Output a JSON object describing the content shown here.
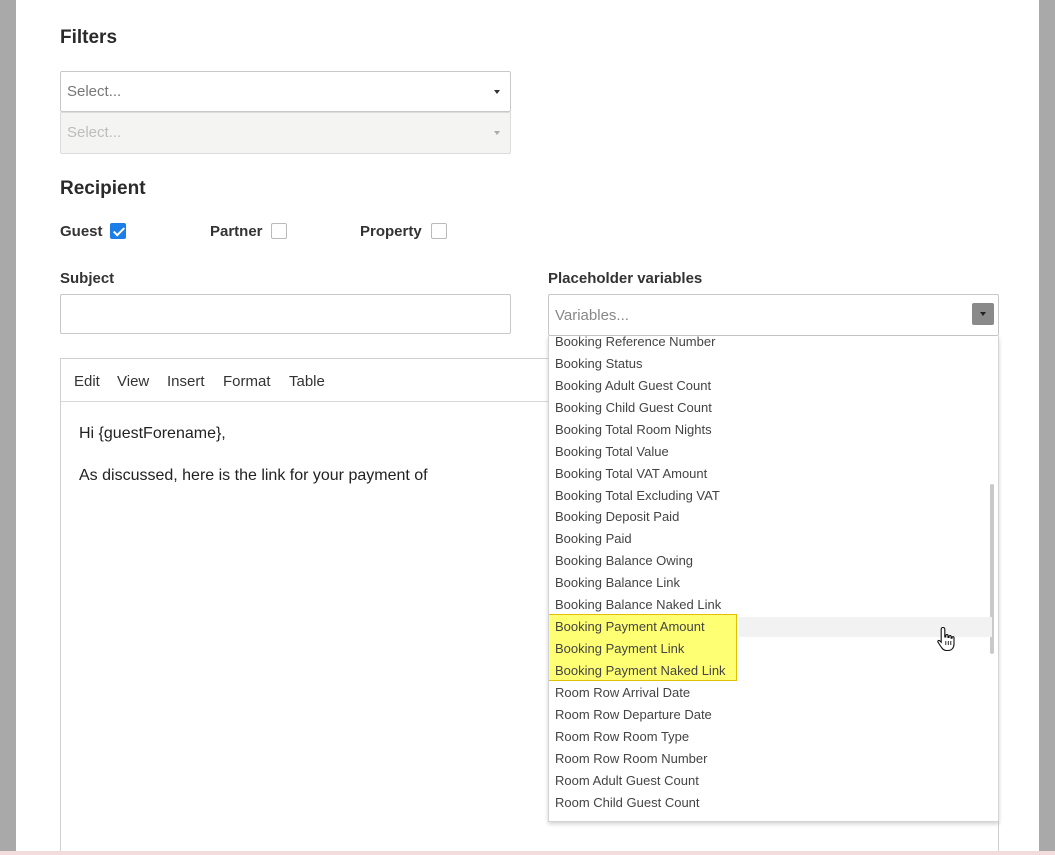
{
  "filters": {
    "heading": "Filters",
    "select1_placeholder": "Select...",
    "select2_placeholder": "Select..."
  },
  "recipient": {
    "heading": "Recipient",
    "guest_label": "Guest",
    "guest_checked": true,
    "partner_label": "Partner",
    "partner_checked": false,
    "property_label": "Property",
    "property_checked": false
  },
  "subject": {
    "label": "Subject",
    "value": ""
  },
  "placeholder_variables": {
    "label": "Placeholder variables",
    "placeholder": "Variables...",
    "options": [
      "Booking Reference Number",
      "Booking Status",
      "Booking Adult Guest Count",
      "Booking Child Guest Count",
      "Booking Total Room Nights",
      "Booking Total Value",
      "Booking Total VAT Amount",
      "Booking Total Excluding VAT",
      "Booking Deposit Paid",
      "Booking Paid",
      "Booking Balance Owing",
      "Booking Balance Link",
      "Booking Balance Naked Link",
      "Booking Payment Amount",
      "Booking Payment Link",
      "Booking Payment Naked Link",
      "Room Row Arrival Date",
      "Room Row Departure Date",
      "Room Row Room Type",
      "Room Row Room Number",
      "Room Adult Guest Count",
      "Room Child Guest Count"
    ],
    "hovered_option": "Booking Payment Amount",
    "highlighted_options": [
      "Booking Payment Amount",
      "Booking Payment Link",
      "Booking Payment Naked Link"
    ],
    "highlight_color": "#ffff00"
  },
  "editor": {
    "menu": [
      "Edit",
      "View",
      "Insert",
      "Format",
      "Table"
    ],
    "line1": "Hi {guestForename},",
    "line2": "As discussed, here is the link for your payment of"
  },
  "colors": {
    "checkbox_accent": "#1e7ee8",
    "overlay": "#a9a9a9"
  }
}
